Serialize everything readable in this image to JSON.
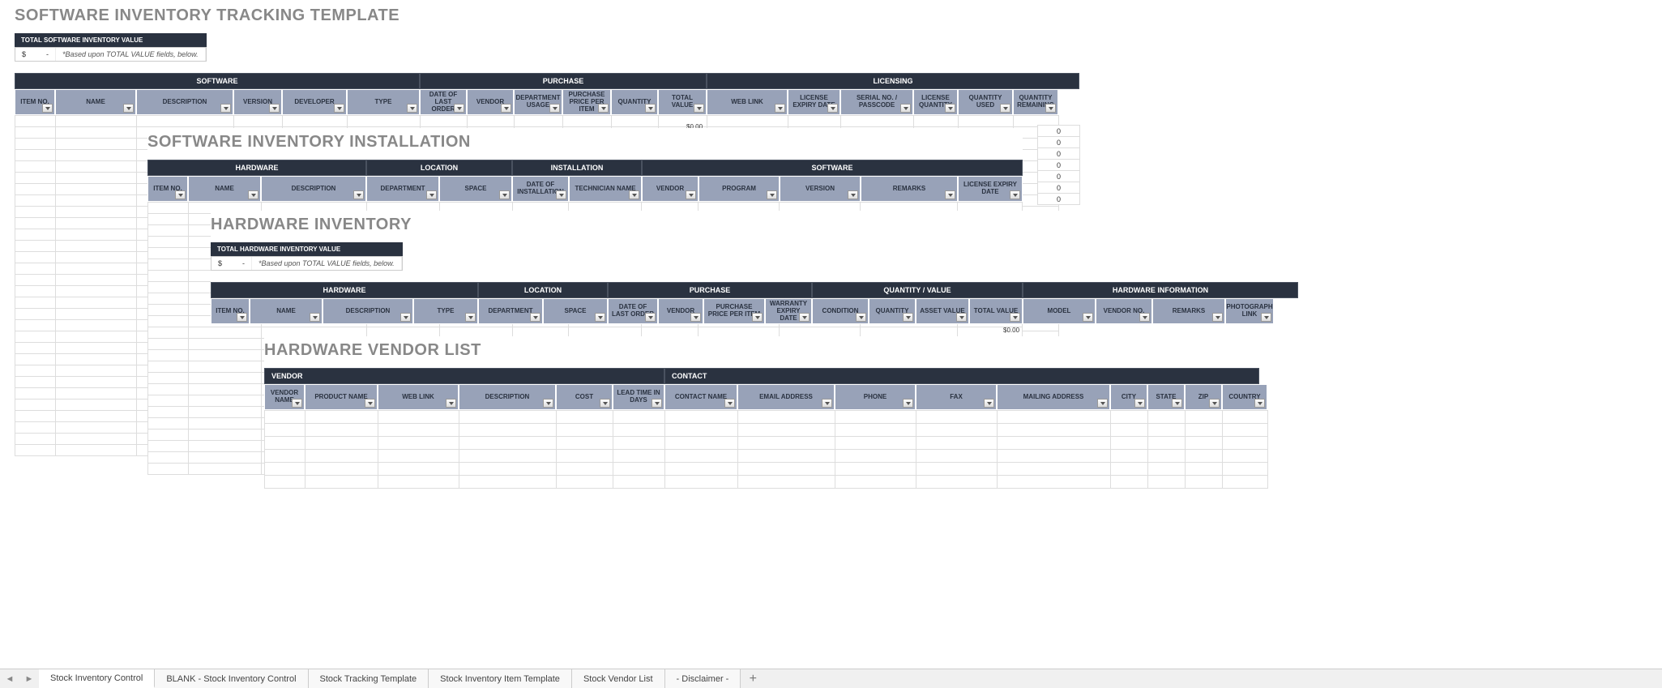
{
  "layer1": {
    "title": "SOFTWARE INVENTORY TRACKING TEMPLATE",
    "valueHeader": "TOTAL SOFTWARE INVENTORY VALUE",
    "currency": "$",
    "dash": "-",
    "based": "*Based upon TOTAL VALUE fields, below.",
    "sections": {
      "software": "SOFTWARE",
      "purchase": "PURCHASE",
      "licensing": "LICENSING"
    },
    "cols": {
      "itemNo": "ITEM NO.",
      "name": "NAME",
      "description": "DESCRIPTION",
      "version": "VERSION",
      "developer": "DEVELOPER",
      "type": "TYPE",
      "dateLastOrder": "DATE OF LAST ORDER",
      "vendor": "VENDOR",
      "deptUsage": "DEPARTMENT USAGE",
      "pricePerItem": "PURCHASE PRICE PER ITEM",
      "quantity": "QUANTITY",
      "totalValue": "TOTAL VALUE",
      "webLink": "WEB LINK",
      "licenseExpiry": "LICENSE EXPIRY DATE",
      "serialPass": "SERIAL NO. / PASSCODE",
      "licenseQty": "LICENSE QUANTITY",
      "qtyUsed": "QUANTITY USED",
      "qtyRemaining": "QUANTITY REMAINING"
    },
    "totalVal": "$0.00",
    "zero": "0"
  },
  "layer2": {
    "title": "SOFTWARE INVENTORY INSTALLATION",
    "sections": {
      "hardware": "HARDWARE",
      "location": "LOCATION",
      "installation": "INSTALLATION",
      "software": "SOFTWARE"
    },
    "cols": {
      "itemNo": "ITEM NO.",
      "name": "NAME",
      "description": "DESCRIPTION",
      "department": "DEPARTMENT",
      "space": "SPACE",
      "installDate": "DATE OF INSTALLATION",
      "technician": "TECHNICIAN NAME",
      "vendor": "VENDOR",
      "program": "PROGRAM",
      "version": "VERSION",
      "remarks": "REMARKS",
      "licenseExpiry": "LICENSE EXPIRY DATE"
    }
  },
  "layer3": {
    "title": "HARDWARE INVENTORY",
    "valueHeader": "TOTAL HARDWARE INVENTORY VALUE",
    "currency": "$",
    "dash": "-",
    "based": "*Based upon TOTAL VALUE fields, below.",
    "sections": {
      "hardware": "HARDWARE",
      "location": "LOCATION",
      "purchase": "PURCHASE",
      "qtyValue": "QUANTITY / VALUE",
      "hwInfo": "HARDWARE INFORMATION"
    },
    "cols": {
      "itemNo": "ITEM NO.",
      "name": "NAME",
      "description": "DESCRIPTION",
      "type": "TYPE",
      "department": "DEPARTMENT",
      "space": "SPACE",
      "dateLastOrder": "DATE OF LAST ORDER",
      "vendor": "VENDOR",
      "pricePerItem": "PURCHASE PRICE PER ITEM",
      "warranty": "WARRANTY EXPIRY DATE",
      "condition": "CONDITION",
      "quantity": "QUANTITY",
      "assetValue": "ASSET VALUE",
      "totalValue": "TOTAL VALUE",
      "model": "MODEL",
      "vendorNo": "VENDOR NO.",
      "remarks": "REMARKS",
      "photoLink": "PHOTOGRAPH LINK"
    },
    "totalVal": "$0.00"
  },
  "layer4": {
    "title": "HARDWARE VENDOR LIST",
    "sections": {
      "vendor": "VENDOR",
      "contact": "CONTACT"
    },
    "cols": {
      "vendorName": "VENDOR NAME",
      "productName": "PRODUCT NAME",
      "webLink": "WEB LINK",
      "description": "DESCRIPTION",
      "cost": "COST",
      "leadTime": "LEAD TIME IN DAYS",
      "contactName": "CONTACT NAME",
      "email": "EMAIL ADDRESS",
      "phone": "PHONE",
      "fax": "FAX",
      "mailAddr": "MAILING ADDRESS",
      "city": "CITY",
      "state": "STATE",
      "zip": "ZIP",
      "country": "COUNTRY"
    }
  },
  "tabs": {
    "items": [
      "Stock Inventory Control",
      "BLANK - Stock Inventory Control",
      "Stock Tracking Template",
      "Stock Inventory Item Template",
      "Stock Vendor List",
      "- Disclaimer -"
    ],
    "active": "Stock Inventory Control"
  }
}
